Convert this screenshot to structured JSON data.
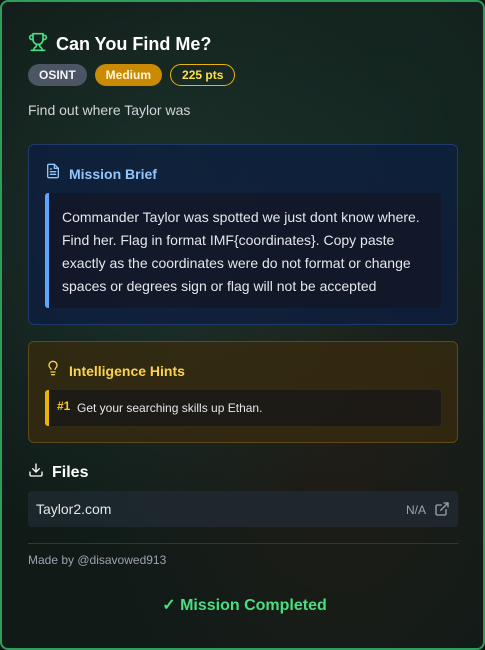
{
  "challenge": {
    "title": "Can You Find Me?",
    "category": "OSINT",
    "difficulty": "Medium",
    "points": "225 pts",
    "description": "Find out where Taylor was"
  },
  "brief": {
    "title": "Mission Brief",
    "text": "Commander Taylor was spotted we just dont know where. Find her. Flag in format IMF{coordinates}. Copy paste exactly as the coordinates were do not format or change spaces or degrees sign or flag will not be accepted"
  },
  "hints": {
    "title": "Intelligence Hints",
    "items": [
      {
        "number": "#1",
        "text": "Get your searching skills up Ethan."
      }
    ]
  },
  "files": {
    "title": "Files",
    "items": [
      {
        "name": "Taylor2.com",
        "size": "N/A"
      }
    ]
  },
  "footer": {
    "credit": "Made by @disavowed913",
    "status": "✓ Mission Completed"
  },
  "colors": {
    "border": "#2f9e5a",
    "brief_accent": "#60a5fa",
    "hint_accent": "#eab308",
    "success": "#4ade80"
  },
  "icons": {
    "title": "trophy-icon",
    "brief": "document-icon",
    "hints": "lightbulb-icon",
    "files": "download-icon",
    "file_link": "external-link-icon"
  }
}
